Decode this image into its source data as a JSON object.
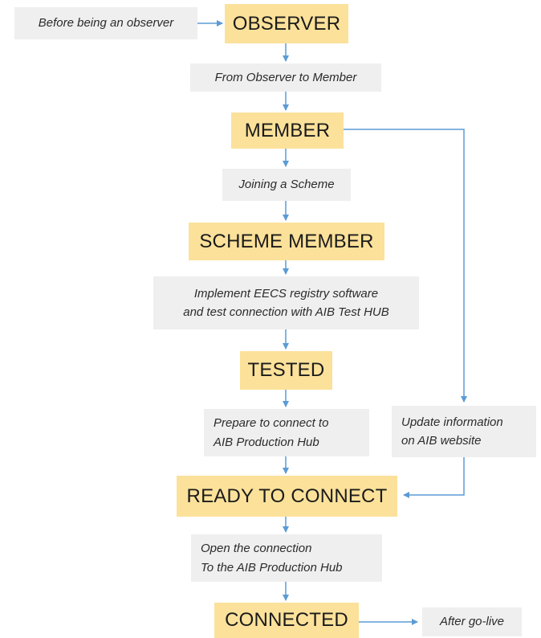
{
  "states": {
    "observer": "OBSERVER",
    "member": "MEMBER",
    "scheme_member": "SCHEME MEMBER",
    "tested": "TESTED",
    "ready_to_connect": "READY TO CONNECT",
    "connected": "CONNECTED"
  },
  "steps": {
    "before_observer": "Before being an observer",
    "observer_to_member": "From Observer to Member",
    "joining_scheme": "Joining a Scheme",
    "implement_registry": "Implement EECS registry software\nand test connection with AIB Test HUB",
    "prepare_connect": "Prepare to connect to\nAIB Production Hub",
    "update_info": "Update information\non AIB website",
    "open_connection": "Open the connection\nTo the AIB Production Hub",
    "after_go_live": "After go-live"
  },
  "colors": {
    "state_fill": "#fbe19a",
    "step_fill": "#efefef",
    "arrow": "#5b9bd5"
  }
}
